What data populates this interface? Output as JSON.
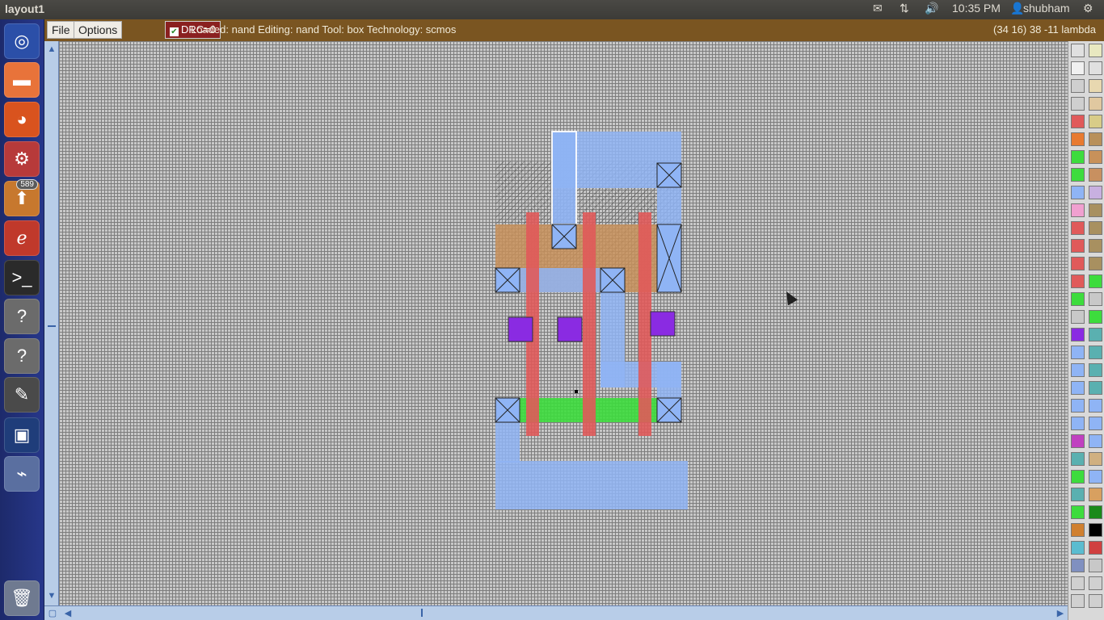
{
  "topbar": {
    "window_title": "layout1",
    "time": "10:35 PM",
    "user": "shubham"
  },
  "launcher": {
    "items": [
      {
        "name": "dash-home",
        "icon": "ubuntu-logo-icon"
      },
      {
        "name": "files",
        "icon": "folder-icon"
      },
      {
        "name": "firefox",
        "icon": "firefox-icon"
      },
      {
        "name": "system-settings",
        "icon": "settings-icon"
      },
      {
        "name": "update-manager",
        "icon": "update-icon",
        "badge": "589"
      },
      {
        "name": "document-viewer",
        "icon": "pdf-viewer-icon"
      },
      {
        "name": "terminal",
        "icon": "terminal-icon"
      },
      {
        "name": "unknown-app-1",
        "icon": "question-icon"
      },
      {
        "name": "unknown-app-2",
        "icon": "question-icon"
      },
      {
        "name": "text-editor",
        "icon": "text-editor-icon"
      },
      {
        "name": "workspace-switcher",
        "icon": "workspace-icon"
      },
      {
        "name": "usb-device",
        "icon": "usb-icon"
      },
      {
        "name": "trash",
        "icon": "trash-icon"
      }
    ]
  },
  "menubar": {
    "file_label": "File",
    "options_label": "Options",
    "drc_label": "DRC=0",
    "status_text": "Loaded: nand Editing: nand Tool: box  Technology: scmos",
    "coords_text": "(34 16) 38 -11 lambda"
  },
  "colors": {
    "menubar_bg": "#7a5521",
    "canvas_bg": "#c8c8c8",
    "metal1": "#8fb4f5",
    "polysilicon": "#e05a5a",
    "ndiffusion": "#3ddc3d",
    "pdiffusion": "#c8915a",
    "contact": "#8a2be2"
  }
}
